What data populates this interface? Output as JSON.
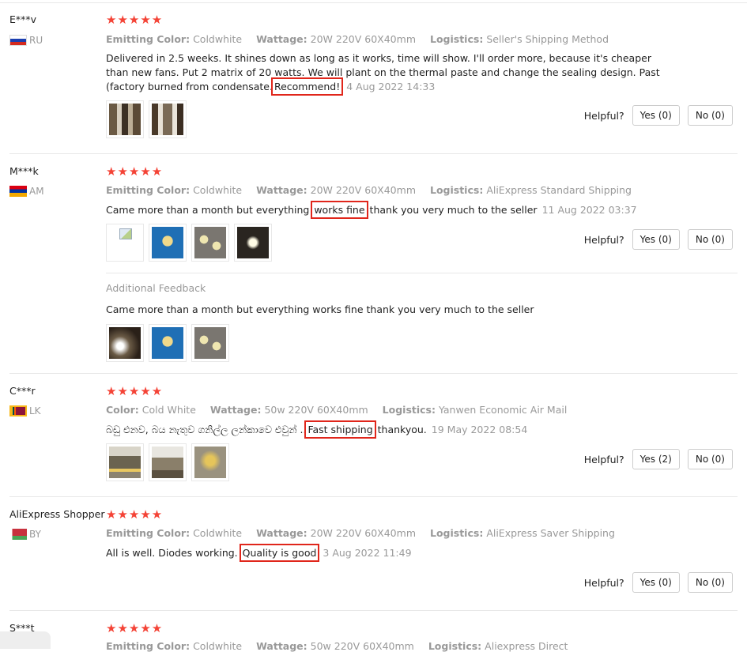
{
  "reviews": [
    {
      "user": "E***v",
      "country": "RU",
      "flag": "russia-flag-icon",
      "stars": "★★★★★",
      "meta": [
        {
          "k": "Emitting Color:",
          "v": "Coldwhite"
        },
        {
          "k": "Wattage:",
          "v": "20W 220V 60X40mm"
        },
        {
          "k": "Logistics:",
          "v": "Seller's Shipping Method"
        }
      ],
      "text_before": "Delivered in 2.5 weeks. It shines down as long as it works, time will show. I'll order more, because it's cheaper than new fans. Put 2 matrix of 20 watts. We will plant on the thermal paste and change the sealing design. Past (factory burned from condensate.",
      "highlight": "Recommend!",
      "text_after": "",
      "date": "4 Aug 2022 14:33",
      "helpful_label": "Helpful?",
      "yes": "Yes (0)",
      "no": "No (0)"
    },
    {
      "user": "M***k",
      "country": "AM",
      "flag": "armenia-flag-icon",
      "stars": "★★★★★",
      "meta": [
        {
          "k": "Emitting Color:",
          "v": "Coldwhite"
        },
        {
          "k": "Wattage:",
          "v": "20W 220V 60X40mm"
        },
        {
          "k": "Logistics:",
          "v": "AliExpress Standard Shipping"
        }
      ],
      "text_before": "Came more than a month but everything",
      "highlight": "works fine",
      "text_after": "thank you very much to the seller",
      "date": "11 Aug 2022 03:37",
      "helpful_label": "Helpful?",
      "yes": "Yes (0)",
      "no": "No (0)",
      "additional_title": "Additional Feedback",
      "additional_text": "Came more than a month but everything works fine thank you very much to the seller"
    },
    {
      "user": "C***r",
      "country": "LK",
      "flag": "sri-lanka-flag-icon",
      "stars": "★★★★★",
      "meta": [
        {
          "k": "Color:",
          "v": "Cold White"
        },
        {
          "k": "Wattage:",
          "v": "50w 220V 60X40mm"
        },
        {
          "k": "Logistics:",
          "v": "Yanwen Economic Air Mail"
        }
      ],
      "text_before": "බඩු එනව, බය නැතුව ගනිල්ල ලන්කාවෙ එවුන් ..",
      "highlight": "Fast shipping",
      "text_after": "thankyou.",
      "date": "19 May 2022 08:54",
      "helpful_label": "Helpful?",
      "yes": "Yes (2)",
      "no": "No (0)"
    },
    {
      "user": "AliExpress Shopper",
      "country": "BY",
      "flag": "belarus-flag-icon",
      "stars": "★★★★★",
      "meta": [
        {
          "k": "Emitting Color:",
          "v": "Coldwhite"
        },
        {
          "k": "Wattage:",
          "v": "20W 220V 60X40mm"
        },
        {
          "k": "Logistics:",
          "v": "AliExpress Saver Shipping"
        }
      ],
      "text_before": "All is well. Diodes working.",
      "highlight": "Quality is good",
      "text_after": "",
      "date": "3 Aug 2022 11:49",
      "helpful_label": "Helpful?",
      "yes": "Yes (0)",
      "no": "No (0)"
    },
    {
      "user": "S***t",
      "stars": "★★★★★",
      "meta": [
        {
          "k": "Emitting Color:",
          "v": "Coldwhite"
        },
        {
          "k": "Wattage:",
          "v": "50w 220V 60X40mm"
        },
        {
          "k": "Logistics:",
          "v": "Aliexpress Direct"
        }
      ]
    }
  ]
}
